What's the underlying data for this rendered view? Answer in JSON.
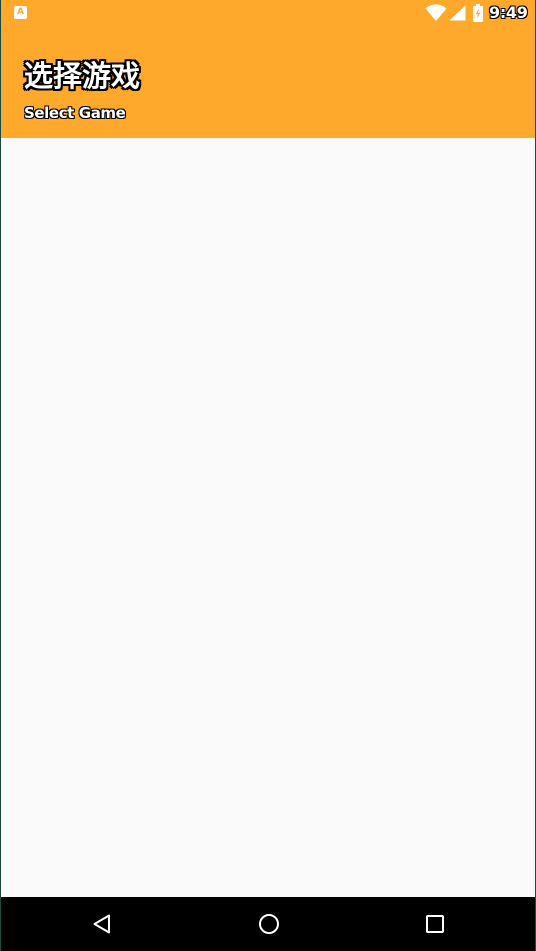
{
  "status_bar": {
    "notification_icon": "A",
    "notification_icon_name": "app-notification-icon",
    "wifi_icon": "wifi-icon",
    "signal_icon": "cell-signal-icon",
    "battery_icon": "battery-charging-icon",
    "time": "9:49"
  },
  "header": {
    "title": "选择游戏",
    "subtitle": "Select Game"
  },
  "navigation_bar": {
    "back_icon": "back-triangle-icon",
    "home_icon": "home-circle-icon",
    "recents_icon": "recents-square-icon"
  },
  "colors": {
    "app_bar": "#ffa92c",
    "content_background": "#fafafa",
    "nav_bar": "#000000",
    "header_text": "#ffffff",
    "text_outline": "#000000"
  }
}
